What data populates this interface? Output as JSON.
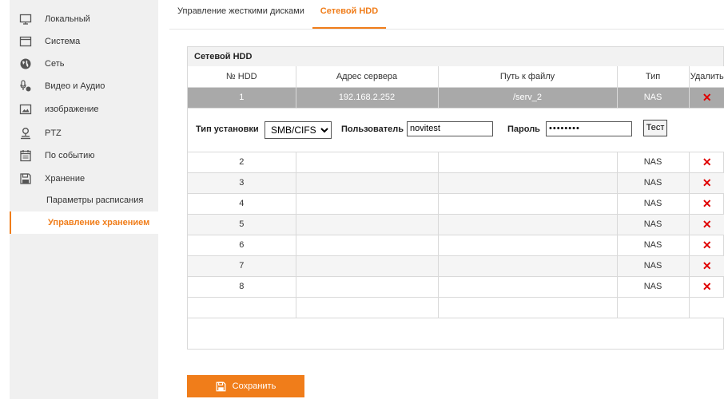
{
  "sidebar": {
    "items": [
      {
        "label": "Локальный",
        "icon": "monitor-icon"
      },
      {
        "label": "Система",
        "icon": "window-icon"
      },
      {
        "label": "Сеть",
        "icon": "globe-icon"
      },
      {
        "label": "Видео и Аудио",
        "icon": "audio-video-icon"
      },
      {
        "label": "изображение",
        "icon": "image-icon"
      },
      {
        "label": "PTZ",
        "icon": "ptz-icon"
      },
      {
        "label": "По событию",
        "icon": "calendar-icon"
      },
      {
        "label": "Хранение",
        "icon": "floppy-icon"
      }
    ],
    "subitems": [
      {
        "label": "Параметры расписания"
      },
      {
        "label": "Управление хранением"
      }
    ]
  },
  "tabs": [
    {
      "label": "Управление жесткими дисками"
    },
    {
      "label": "Сетевой HDD"
    }
  ],
  "panel": {
    "title": "Сетевой HDD",
    "columns": [
      "№ HDD",
      "Адрес сервера",
      "Путь к файлу",
      "Тип",
      "Удалить"
    ],
    "selected_row": {
      "hdd": "1",
      "server": "192.168.2.252",
      "path": "/serv_2",
      "type": "NAS"
    },
    "detail": {
      "mount_type_label": "Тип установки",
      "mount_type_value": "SMB/CIFS",
      "user_label": "Пользователь",
      "user_value": "novitest",
      "password_label": "Пароль",
      "password_value": "••••••••",
      "test_label": "Тест"
    },
    "rows": [
      {
        "hdd": "2",
        "type": "NAS"
      },
      {
        "hdd": "3",
        "type": "NAS"
      },
      {
        "hdd": "4",
        "type": "NAS"
      },
      {
        "hdd": "5",
        "type": "NAS"
      },
      {
        "hdd": "6",
        "type": "NAS"
      },
      {
        "hdd": "7",
        "type": "NAS"
      },
      {
        "hdd": "8",
        "type": "NAS"
      }
    ],
    "delete_glyph": "✕"
  },
  "save_label": "Сохранить",
  "colors": {
    "accent": "#f07d1a",
    "selected_row": "#a9a9a9",
    "delete": "#e00000"
  }
}
